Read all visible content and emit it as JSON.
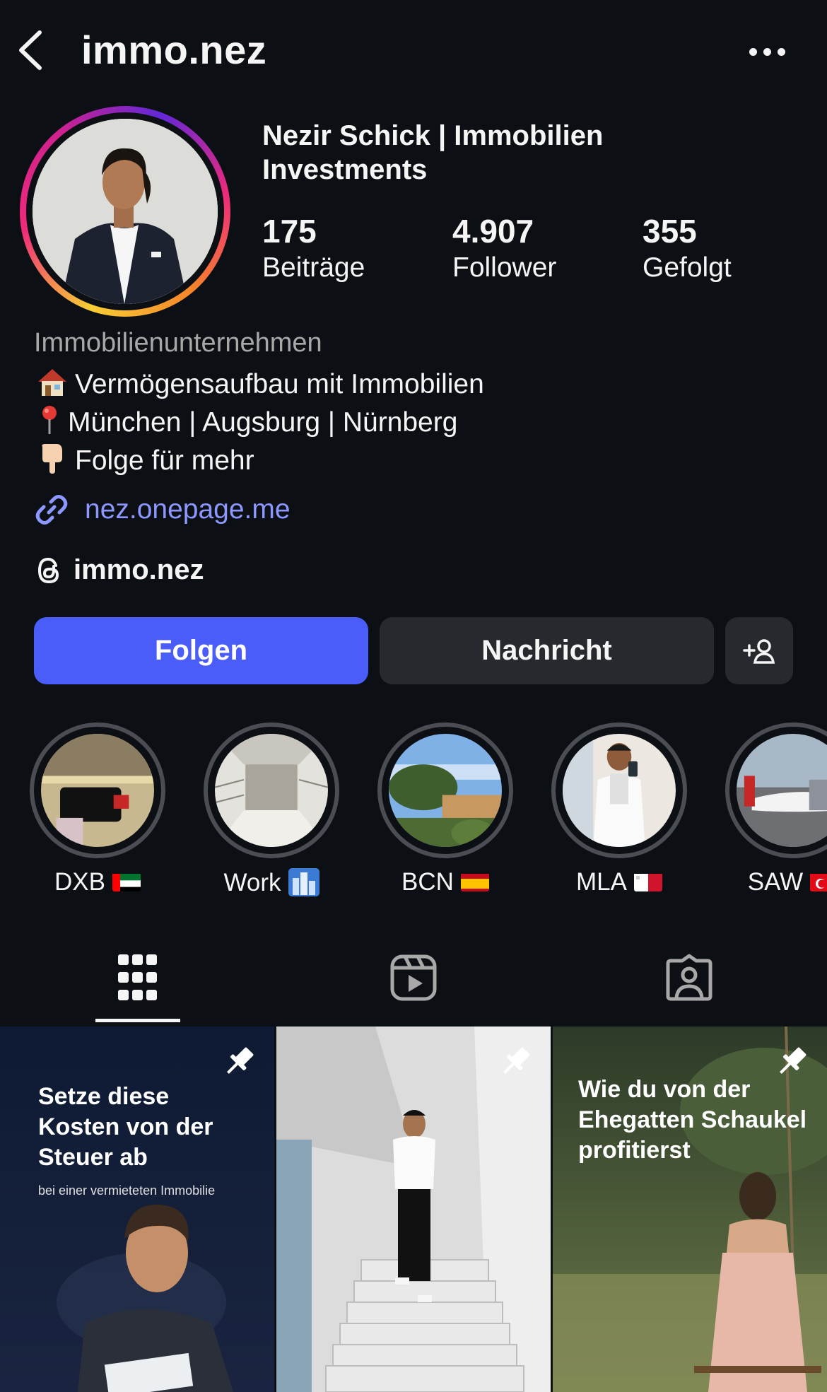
{
  "header": {
    "username": "immo.nez"
  },
  "profile": {
    "display_name": "Nezir Schick | Immobilien Investments",
    "stats": [
      {
        "value": "175",
        "label": "Beiträge"
      },
      {
        "value": "4.907",
        "label": "Follower"
      },
      {
        "value": "355",
        "label": "Gefolgt"
      }
    ],
    "category": "Immobilienunternehmen",
    "bio": [
      {
        "icon": "house-emoji",
        "text": "Vermögensaufbau mit Immobilien"
      },
      {
        "icon": "pin-emoji",
        "text": "München | Augsburg | Nürnberg"
      },
      {
        "icon": "pointing-down-emoji",
        "text": "Folge für mehr"
      }
    ],
    "link": "nez.onepage.me",
    "threads_handle": "immo.nez"
  },
  "actions": {
    "follow_label": "Folgen",
    "message_label": "Nachricht"
  },
  "highlights": [
    {
      "label": "DXB",
      "flag": "uae-flag"
    },
    {
      "label": "Work",
      "flag": "city-emoji"
    },
    {
      "label": "BCN",
      "flag": "spain-flag"
    },
    {
      "label": "MLA",
      "flag": "malta-flag"
    },
    {
      "label": "SAW",
      "flag": "turkey-flag"
    }
  ],
  "tabs": [
    "grid-tab",
    "reels-tab",
    "tagged-tab"
  ],
  "posts": [
    {
      "title": "Setze diese Kosten von der Steuer ab",
      "subtitle": "bei einer vermieteten Immobilie",
      "pinned": true
    },
    {
      "title": "",
      "subtitle": "",
      "pinned": true
    },
    {
      "title": "Wie du von der Ehegatten Schaukel profitierst",
      "subtitle": "",
      "pinned": true
    }
  ],
  "colors": {
    "background": "#0c1014",
    "follow_button": "#4a5df9",
    "secondary_button": "#262a2e",
    "link": "#8c98ff"
  }
}
